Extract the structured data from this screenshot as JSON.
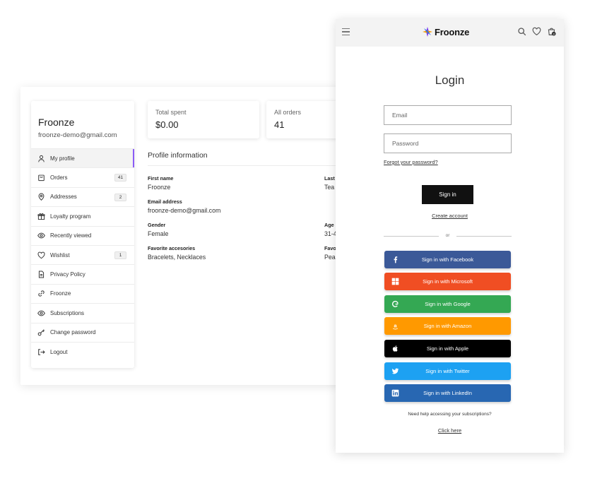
{
  "account": {
    "sidebar": {
      "name": "Froonze",
      "email": "froonze-demo@gmail.com",
      "items": [
        {
          "label": "My profile",
          "icon": "user-icon",
          "badge": ""
        },
        {
          "label": "Orders",
          "icon": "bag-icon",
          "badge": "41"
        },
        {
          "label": "Addresses",
          "icon": "location-pin-icon",
          "badge": "2"
        },
        {
          "label": "Loyalty program",
          "icon": "gift-icon",
          "badge": ""
        },
        {
          "label": "Recently viewed",
          "icon": "eye-icon",
          "badge": ""
        },
        {
          "label": "Wishlist",
          "icon": "heart-icon",
          "badge": "1"
        },
        {
          "label": "Privacy Policy",
          "icon": "document-icon",
          "badge": ""
        },
        {
          "label": "Froonze",
          "icon": "link-icon",
          "badge": ""
        },
        {
          "label": "Subscriptions",
          "icon": "eye-icon",
          "badge": ""
        },
        {
          "label": "Change password",
          "icon": "key-icon",
          "badge": ""
        },
        {
          "label": "Logout",
          "icon": "logout-icon",
          "badge": ""
        }
      ],
      "active_index": 0,
      "active_color": "#8b5cf6"
    },
    "stats": [
      {
        "label": "Total spent",
        "value": "$0.00"
      },
      {
        "label": "All orders",
        "value": "41"
      }
    ],
    "profile": {
      "title": "Profile information",
      "fields": [
        {
          "label": "First name",
          "value": "Froonze"
        },
        {
          "label": "Email address",
          "value": "froonze-demo@gmail.com"
        },
        {
          "label": "Gender",
          "value": "Female"
        },
        {
          "label": "Favorite accesories",
          "value": "Bracelets, Necklaces"
        },
        {
          "label": "Last",
          "value": "Tea"
        },
        {
          "label": "Age",
          "value": "31-4"
        },
        {
          "label": "Favo",
          "value": "Pea"
        }
      ]
    }
  },
  "login": {
    "topbar": {
      "logo_text": "Froonze",
      "cart_count": "0",
      "icons": [
        "menu-icon",
        "search-icon",
        "heart-icon",
        "cart-icon"
      ]
    },
    "title": "Login",
    "email_placeholder": "Email",
    "password_placeholder": "Password",
    "forgot_label": "Forgot your password?",
    "signin_label": "Sign in",
    "create_label": "Create account",
    "or_label": "or",
    "social_buttons": [
      {
        "label": "Sign in with Facebook",
        "color": "#3b5998",
        "icon": "facebook-icon"
      },
      {
        "label": "Sign in with Microsoft",
        "color": "#f04e23",
        "icon": "microsoft-icon"
      },
      {
        "label": "Sign in with Google",
        "color": "#34a853",
        "icon": "google-icon"
      },
      {
        "label": "Sign in with Amazon",
        "color": "#ff9900",
        "icon": "amazon-icon"
      },
      {
        "label": "Sign in with Apple",
        "color": "#000000",
        "icon": "apple-icon"
      },
      {
        "label": "Sign in with Twitter",
        "color": "#1da1f2",
        "icon": "twitter-icon"
      },
      {
        "label": "Sign in with LinkedIn",
        "color": "#2867b2",
        "icon": "linkedin-icon"
      }
    ],
    "help_text": "Need help accessing your subscriptions?",
    "click_here_label": "Click here"
  }
}
